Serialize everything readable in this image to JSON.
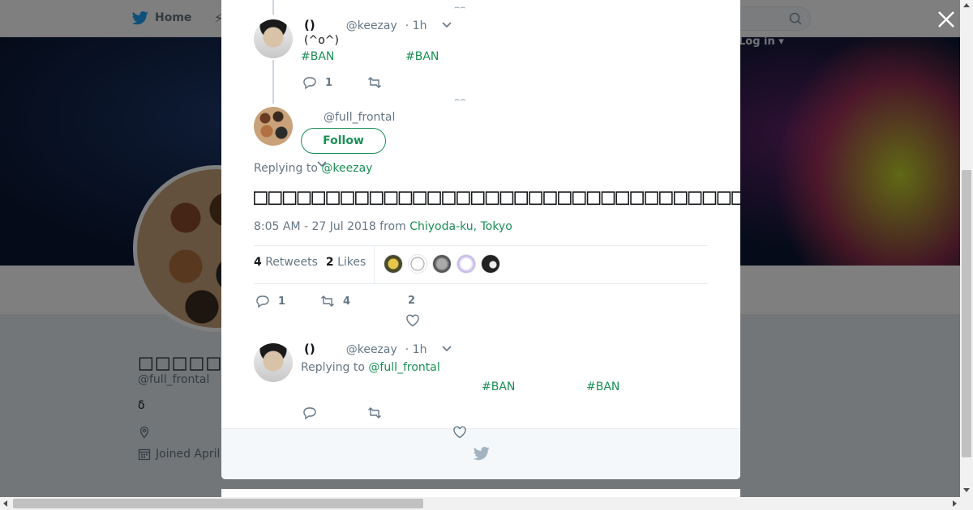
{
  "topbar": {
    "home_label": "Home",
    "moments_glyph": "⚡",
    "login_label": "Log in"
  },
  "profile": {
    "name": "□□□□□□□□",
    "handle": "@full_frontal",
    "bio": "δ",
    "joined": "Joined April"
  },
  "thread": {
    "reply1": {
      "name": "()",
      "handle": "@keezay",
      "time": "· 1h",
      "text": "(^o^)",
      "hashtags": [
        "#BAN",
        "#BAN"
      ],
      "reply_count": "1"
    },
    "main": {
      "handle": "@full_frontal",
      "follow_label": "Follow",
      "replying_to_label": "Replying to",
      "replying_to_user": "@keezay",
      "text": "□□□□□□□□□□□□□□□□□□□□□□□□□□□□□□□□□□□□□□□□□□□□□",
      "timestamp": "8:05 AM - 27 Jul 2018 from",
      "location": "Chiyoda-ku, Tokyo",
      "retweet_count": "4",
      "retweets_label": "Retweets",
      "like_count": "2",
      "likes_label": "Likes",
      "action_reply_count": "1",
      "action_retweet_count": "4",
      "action_like_count": "2"
    },
    "reply2": {
      "name": "()",
      "handle": "@keezay",
      "time": "· 1h",
      "replying_to_label": "Replying to",
      "replying_to_user": "@full_frontal",
      "hashtags": [
        "#BAN",
        "#BAN"
      ]
    }
  },
  "colors": {
    "accent": "#1b8f55",
    "twitter_blue": "#1da1f2",
    "overlay": "rgba(0,0,0,0.5)"
  },
  "icons": [
    "twitter-bird-icon",
    "search-icon",
    "close-icon",
    "chevron-down-icon",
    "reply-icon",
    "retweet-icon",
    "heart-icon",
    "location-icon",
    "calendar-icon"
  ]
}
